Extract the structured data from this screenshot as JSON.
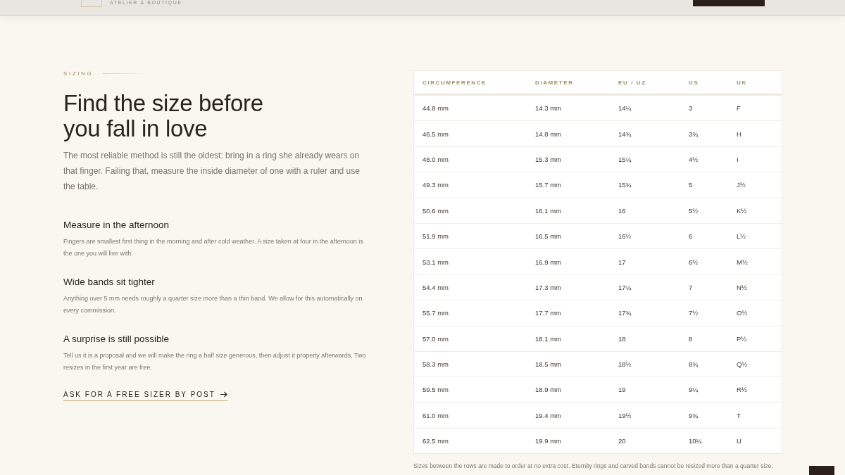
{
  "header": {
    "tagline": "ATELIER & BOUTIQUE"
  },
  "section": {
    "eyebrow": "SIZING",
    "title": "Find the size before you fall in love",
    "intro": "The most reliable method is still the oldest: bring in a ring she already wears on that finger. Failing that, measure the inside diameter of one with a ruler and use the table.",
    "tips": [
      {
        "heading": "Measure in the afternoon",
        "body": "Fingers are smallest first thing in the morning and after cold weather. A size taken at four in the afternoon is the one you will live with."
      },
      {
        "heading": "Wide bands sit tighter",
        "body": "Anything over 5 mm needs roughly a quarter size more than a thin band. We allow for this automatically on every commission."
      },
      {
        "heading": "A surprise is still possible",
        "body": "Tell us it is a proposal and we will make the ring a half size generous, then adjust it properly afterwards. Two resizes in the first year are free."
      }
    ],
    "link": "ASK FOR A FREE SIZER BY POST"
  },
  "table": {
    "columns": [
      "CIRCUMFERENCE",
      "DIAMETER",
      "EU / UZ",
      "US",
      "UK"
    ],
    "rows": [
      [
        "44.8 mm",
        "14.3 mm",
        "14¼",
        "3",
        "F"
      ],
      [
        "46.5 mm",
        "14.8 mm",
        "14¾",
        "3¾",
        "H"
      ],
      [
        "48.0 mm",
        "15.3 mm",
        "15¼",
        "4½",
        "I"
      ],
      [
        "49.3 mm",
        "15.7 mm",
        "15¾",
        "5",
        "J½"
      ],
      [
        "50.6 mm",
        "16.1 mm",
        "16",
        "5½",
        "K½"
      ],
      [
        "51.9 mm",
        "16.5 mm",
        "16½",
        "6",
        "L½"
      ],
      [
        "53.1 mm",
        "16.9 mm",
        "17",
        "6½",
        "M½"
      ],
      [
        "54.4 mm",
        "17.3 mm",
        "17¼",
        "7",
        "N½"
      ],
      [
        "55.7 mm",
        "17.7 mm",
        "17¾",
        "7½",
        "O½"
      ],
      [
        "57.0 mm",
        "18.1 mm",
        "18",
        "8",
        "P½"
      ],
      [
        "58.3 mm",
        "18.5 mm",
        "18½",
        "8¾",
        "Q½"
      ],
      [
        "59.5 mm",
        "18.9 mm",
        "19",
        "9¼",
        "R½"
      ],
      [
        "61.0 mm",
        "19.4 mm",
        "19½",
        "9¾",
        "T"
      ],
      [
        "62.5 mm",
        "19.9 mm",
        "20",
        "10¼",
        "U"
      ]
    ],
    "note": "Sizes between the rows are made to order at no extra cost. Eternity rings and carved bands cannot be resized more than a quarter size,"
  }
}
